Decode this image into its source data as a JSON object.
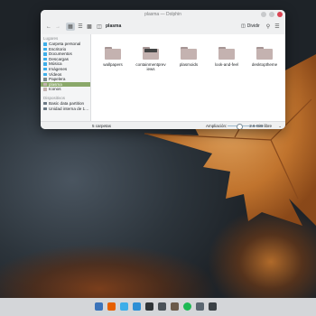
{
  "window": {
    "title": "plasma — Dolphin",
    "breadcrumb": "plasma",
    "split_label": "Dividir",
    "status": {
      "items_count": "5 carpetas",
      "zoom_label": "Ampliación:",
      "zoom_level": 0.3,
      "free_space": "2.6 GiB libre",
      "disk_used": 0.13
    }
  },
  "sidebar": {
    "sections": {
      "places": "Lugares",
      "devices": "Dispositivos"
    },
    "places": [
      {
        "label": "Carpeta personal",
        "icon": "home-icon",
        "color": "#3daee9"
      },
      {
        "label": "Escritorio",
        "icon": "desktop-icon",
        "color": "#3daee9"
      },
      {
        "label": "Documentos",
        "icon": "documents-icon",
        "color": "#3daee9"
      },
      {
        "label": "Descargas",
        "icon": "downloads-icon",
        "color": "#3daee9"
      },
      {
        "label": "Música",
        "icon": "music-icon",
        "color": "#3daee9"
      },
      {
        "label": "Imágenes",
        "icon": "pictures-icon",
        "color": "#3daee9"
      },
      {
        "label": "Vídeos",
        "icon": "videos-icon",
        "color": "#3daee9"
      },
      {
        "label": "Papelera",
        "icon": "trash-icon",
        "color": "#7f8c8d"
      },
      {
        "label": "plasma",
        "icon": "folder-icon",
        "color": "#c4b2b0",
        "selected": true
      },
      {
        "label": "Iconos",
        "icon": "folder-icon",
        "color": "#c4b2b0"
      }
    ],
    "devices": [
      {
        "label": "Basic data partition",
        "icon": "drive-icon",
        "color": "#6d7a86"
      },
      {
        "label": "Unidad interna de 1…",
        "icon": "drive-icon",
        "color": "#6d7a86"
      }
    ]
  },
  "folders": [
    {
      "name": "wallpapers",
      "icon": "folder-icon"
    },
    {
      "name": "containmentpreviews",
      "icon": "folder-icon"
    },
    {
      "name": "plasmoids",
      "icon": "folder-icon"
    },
    {
      "name": "look-and-feel",
      "icon": "folder-icon"
    },
    {
      "name": "desktoptheme",
      "icon": "folder-icon"
    }
  ],
  "taskbar": {
    "apps": [
      {
        "name": "app-launcher-icon",
        "color": "#3b73b9"
      },
      {
        "name": "firefox-icon",
        "color": "#e66000"
      },
      {
        "name": "discover-icon",
        "color": "#3daee9"
      },
      {
        "name": "dolphin-icon",
        "color": "#2d8fd5"
      },
      {
        "name": "konsole-icon",
        "color": "#2f3437"
      },
      {
        "name": "screenshot-icon",
        "color": "#4a5258"
      },
      {
        "name": "gimp-icon",
        "color": "#6b5a4a"
      },
      {
        "name": "spotify-icon",
        "color": "#1db954"
      },
      {
        "name": "kate-icon",
        "color": "#5a6670"
      },
      {
        "name": "system-monitor-icon",
        "color": "#3a4045"
      }
    ]
  },
  "colors": {
    "accent": "#3daee9",
    "selection": "#8aa86a"
  }
}
